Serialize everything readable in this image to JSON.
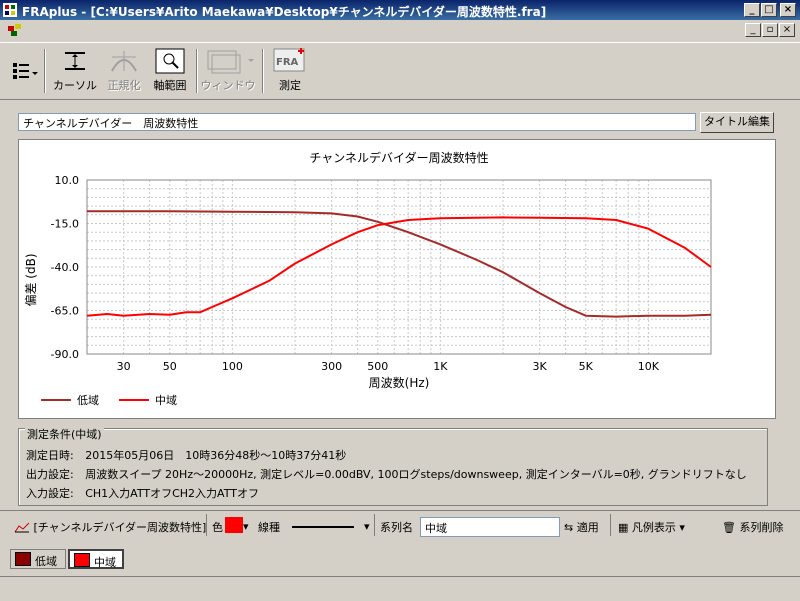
{
  "window": {
    "title": "FRAplus - [C:¥Users¥Arito Maekawa¥Desktop¥チャンネルデバイダー周波数特性.fra]"
  },
  "toolbar": {
    "cursor_label": "カーソル",
    "normalize_label": "正規化",
    "axis_range_label": "軸範囲",
    "window_label": "ウィンドウ",
    "measure_label": "測定",
    "fra_logo": "FRA"
  },
  "title_bar": {
    "value": "チャンネルデバイダー　周波数特性",
    "edit_button": "タイトル編集"
  },
  "conditions": {
    "group_label": "測定条件(中域)",
    "rows": [
      {
        "label": "測定日時:",
        "value": "2015年05月06日　10時36分48秒～10時37分41秒"
      },
      {
        "label": "出力設定:",
        "value": "周波数スイープ 20Hz～20000Hz, 測定レベル=0.00dBV, 100ログsteps/downsweep, 測定インターバル=0秒, グランドリフトなし"
      },
      {
        "label": "入力設定:",
        "value": "CH1入力ATTオフCH2入力ATTオフ"
      }
    ]
  },
  "series_bar": {
    "series_ref": "[チャンネルデバイダー周波数特性]",
    "color_label": "色",
    "line_type_label": "線種",
    "name_label": "系列名",
    "name_value": "中域",
    "apply_label": "適用",
    "legend_label": "凡例表示",
    "delete_label": "系列削除",
    "selected_color": "#ff0000"
  },
  "tabs": [
    {
      "label": "低域",
      "color": "#8b0000"
    },
    {
      "label": "中域",
      "color": "#ff0000"
    }
  ],
  "chart_data": {
    "type": "line",
    "title": "チャンネルデバイダー周波数特性",
    "xlabel": "周波数(Hz)",
    "ylabel": "偏差 (dB)",
    "x_scale": "log",
    "xlim": [
      20,
      20000
    ],
    "ylim": [
      -90,
      10
    ],
    "y_ticks": [
      10.0,
      -15.0,
      -40.0,
      -65.0,
      -90.0
    ],
    "y_tick_labels": [
      "10.0",
      "-15.0",
      "-40.0",
      "-65.0",
      "-90.0"
    ],
    "x_ticks": [
      30,
      50,
      100,
      300,
      500,
      1000,
      3000,
      5000,
      10000
    ],
    "x_tick_labels": [
      "30",
      "50",
      "100",
      "300",
      "500",
      "1K",
      "3K",
      "5K",
      "10K"
    ],
    "grid": true,
    "legend_position": "bottom-left",
    "series": [
      {
        "name": "低域",
        "color": "#a52a2a",
        "x": [
          20,
          50,
          100,
          200,
          300,
          400,
          500,
          700,
          1000,
          1500,
          2000,
          3000,
          4000,
          5000,
          7000,
          10000,
          15000,
          20000
        ],
        "y": [
          -8,
          -8,
          -8.2,
          -8.5,
          -9.2,
          -11,
          -14,
          -20,
          -27,
          -36,
          -43,
          -55,
          -63,
          -68,
          -68.5,
          -68,
          -68,
          -67.5
        ]
      },
      {
        "name": "中域",
        "color": "#ff0000",
        "x": [
          20,
          25,
          30,
          40,
          50,
          60,
          70,
          80,
          100,
          150,
          200,
          300,
          400,
          500,
          700,
          1000,
          2000,
          3000,
          5000,
          7000,
          10000,
          15000,
          20000
        ],
        "y": [
          -68,
          -67,
          -68,
          -67,
          -67.5,
          -66,
          -66,
          -63,
          -58,
          -48,
          -38,
          -27,
          -20,
          -16,
          -13,
          -12,
          -11.5,
          -11.7,
          -12,
          -13,
          -18,
          -29,
          -40
        ]
      }
    ]
  }
}
